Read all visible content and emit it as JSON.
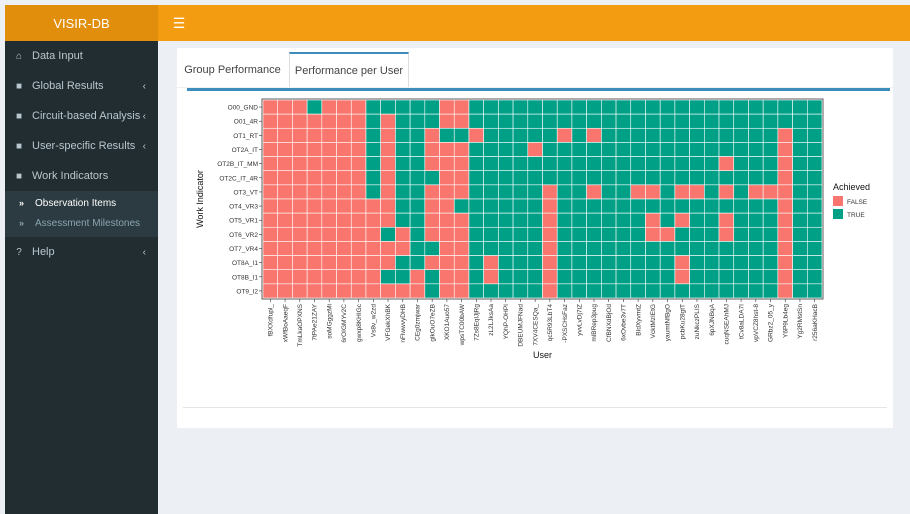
{
  "app": {
    "title": "VISIR-DB"
  },
  "sidebar": {
    "items": [
      {
        "label": "Data Input",
        "icon": "home-icon",
        "expandable": false
      },
      {
        "label": "Global Results",
        "icon": "folder-icon",
        "expandable": true
      },
      {
        "label": "Circuit-based Analysis",
        "icon": "folder-icon",
        "expandable": true
      },
      {
        "label": "User-specific Results",
        "icon": "folder-icon",
        "expandable": true
      },
      {
        "label": "Work Indicators",
        "icon": "folder-icon",
        "expandable": true,
        "expanded": true
      }
    ],
    "subitems": [
      {
        "label": "Observation Items",
        "active": true
      },
      {
        "label": "Assessment Milestones",
        "active": false
      }
    ],
    "help": {
      "label": "Help",
      "icon": "question-circle-icon"
    }
  },
  "tabs": [
    {
      "label": "Group Performance",
      "active": false
    },
    {
      "label": "Performance per User",
      "active": true
    }
  ],
  "colors": {
    "false": "#F8766D",
    "true": "#00A087",
    "accent": "#f39c12",
    "sidebar": "#222d32",
    "tab_active": "#3c8dbc"
  },
  "chart_data": {
    "type": "heatmap",
    "xlabel": "User",
    "ylabel": "Work Indicator",
    "legend": {
      "title": "Achieved",
      "entries": [
        "FALSE",
        "TRUE"
      ],
      "position": "right"
    },
    "y": [
      "O00_GND",
      "O01_4R",
      "OT1_RT",
      "OT2A_IT",
      "OT2B_IT_MM",
      "OT2C_IT_4R",
      "OT3_VT",
      "OT4_VR3",
      "OT5_VR1",
      "OT6_VR2",
      "OT7_VR4",
      "OT8A_I1",
      "OT8B_I1",
      "OT9_I2"
    ],
    "x": [
      "fBXXdfupl_",
      "xWfBoAaeqF",
      "TmLkaOPXNS",
      "7tPAe21ZAY",
      "soMGggzMi",
      "6rOIGMYv2C",
      "gwxp8KHIGc",
      "Vs8v_w2zd",
      "VFGekXhBK",
      "nFlwwvyDHB",
      "CEg0zmjwar",
      "glkOuO7eZB",
      "XKO1Auo57",
      "wpsTC00bAW",
      "7Zs8EqlJjRg",
      "zL2LJksAa",
      "YQhP-OHPI",
      "DBEUMJFNad",
      "7XV4CESQa_",
      "qc5R93LbT4",
      "-PXSCHsFaz",
      "yvvLvDj7iZ",
      "mlBRep3pug",
      "CfBNXdBjOd",
      "6xOvbe3v7T",
      "BIdXyvmtZ",
      "VcktMzIEtG",
      "yaumtNfBgO",
      "pcbKu28gtT",
      "zuNkczPLIS",
      "6pXJNBqA",
      "cuqNSEAhMJ",
      "tCv8aLDA7I",
      "vpVCZ8hst-8",
      "GRbz2_05_y",
      "Y6P9Lb4eg",
      "Yg2RMstSn",
      "r256aKHacB"
    ],
    "values": [
      [
        0,
        0,
        0,
        1,
        0,
        0,
        0,
        1,
        1,
        1,
        1,
        1,
        0,
        0,
        1,
        1,
        1,
        1,
        1,
        1,
        1,
        1,
        1,
        1,
        1,
        1,
        1,
        1,
        1,
        1,
        1,
        1,
        1,
        1,
        1,
        1,
        1,
        1
      ],
      [
        0,
        0,
        0,
        0,
        0,
        0,
        0,
        1,
        0,
        1,
        1,
        1,
        0,
        0,
        1,
        1,
        1,
        1,
        1,
        1,
        1,
        1,
        1,
        1,
        1,
        1,
        1,
        1,
        1,
        1,
        1,
        1,
        1,
        1,
        1,
        1,
        1,
        1
      ],
      [
        0,
        0,
        0,
        0,
        0,
        0,
        0,
        1,
        0,
        1,
        1,
        0,
        1,
        1,
        0,
        1,
        1,
        1,
        1,
        1,
        0,
        1,
        0,
        1,
        1,
        1,
        1,
        1,
        1,
        1,
        1,
        1,
        1,
        1,
        1,
        0,
        1,
        1
      ],
      [
        0,
        0,
        0,
        0,
        0,
        0,
        0,
        1,
        0,
        1,
        1,
        0,
        0,
        0,
        1,
        1,
        1,
        1,
        0,
        1,
        1,
        1,
        1,
        1,
        1,
        1,
        1,
        1,
        1,
        1,
        1,
        1,
        1,
        1,
        1,
        0,
        1,
        1
      ],
      [
        0,
        0,
        0,
        0,
        0,
        0,
        0,
        1,
        0,
        1,
        1,
        0,
        0,
        0,
        1,
        1,
        1,
        1,
        1,
        1,
        1,
        1,
        1,
        1,
        1,
        1,
        1,
        1,
        1,
        1,
        1,
        0,
        1,
        1,
        1,
        0,
        1,
        1
      ],
      [
        0,
        0,
        0,
        0,
        0,
        0,
        0,
        1,
        0,
        1,
        1,
        1,
        0,
        0,
        1,
        1,
        1,
        1,
        1,
        1,
        1,
        1,
        1,
        1,
        1,
        1,
        1,
        1,
        1,
        1,
        1,
        1,
        1,
        1,
        1,
        0,
        1,
        1
      ],
      [
        0,
        0,
        0,
        0,
        0,
        0,
        0,
        1,
        0,
        1,
        1,
        0,
        0,
        0,
        1,
        1,
        1,
        1,
        1,
        0,
        1,
        1,
        0,
        1,
        1,
        0,
        0,
        1,
        0,
        0,
        1,
        0,
        1,
        0,
        0,
        0,
        1,
        1
      ],
      [
        0,
        0,
        0,
        0,
        0,
        0,
        0,
        0,
        0,
        1,
        1,
        0,
        0,
        1,
        1,
        1,
        1,
        1,
        1,
        0,
        1,
        1,
        1,
        1,
        1,
        1,
        1,
        1,
        1,
        1,
        1,
        1,
        1,
        1,
        1,
        0,
        1,
        1
      ],
      [
        0,
        0,
        0,
        0,
        0,
        0,
        0,
        0,
        0,
        1,
        1,
        0,
        0,
        0,
        1,
        1,
        1,
        1,
        1,
        0,
        1,
        1,
        1,
        1,
        1,
        1,
        0,
        1,
        0,
        1,
        1,
        0,
        1,
        1,
        1,
        0,
        1,
        1
      ],
      [
        0,
        0,
        0,
        0,
        0,
        0,
        0,
        0,
        1,
        0,
        1,
        0,
        0,
        0,
        1,
        1,
        1,
        1,
        1,
        0,
        1,
        1,
        1,
        1,
        1,
        1,
        0,
        0,
        1,
        1,
        1,
        0,
        1,
        1,
        1,
        0,
        1,
        1
      ],
      [
        0,
        0,
        0,
        0,
        0,
        0,
        0,
        0,
        0,
        0,
        1,
        1,
        0,
        0,
        1,
        1,
        1,
        1,
        1,
        0,
        1,
        1,
        1,
        1,
        1,
        1,
        1,
        1,
        1,
        1,
        1,
        1,
        1,
        1,
        1,
        0,
        1,
        1
      ],
      [
        0,
        0,
        0,
        0,
        0,
        0,
        0,
        0,
        0,
        1,
        1,
        0,
        0,
        0,
        1,
        0,
        1,
        1,
        1,
        0,
        1,
        1,
        1,
        1,
        1,
        1,
        1,
        1,
        0,
        1,
        1,
        1,
        1,
        1,
        1,
        0,
        1,
        1
      ],
      [
        0,
        0,
        0,
        0,
        0,
        0,
        0,
        0,
        1,
        1,
        0,
        1,
        0,
        0,
        1,
        0,
        1,
        1,
        1,
        0,
        1,
        1,
        1,
        1,
        1,
        1,
        1,
        1,
        0,
        1,
        1,
        1,
        1,
        1,
        1,
        0,
        1,
        1
      ],
      [
        0,
        0,
        0,
        0,
        0,
        0,
        0,
        0,
        0,
        0,
        0,
        1,
        0,
        0,
        1,
        1,
        1,
        1,
        1,
        0,
        1,
        1,
        1,
        1,
        1,
        1,
        1,
        1,
        1,
        1,
        1,
        1,
        1,
        1,
        1,
        0,
        1,
        1
      ]
    ]
  }
}
